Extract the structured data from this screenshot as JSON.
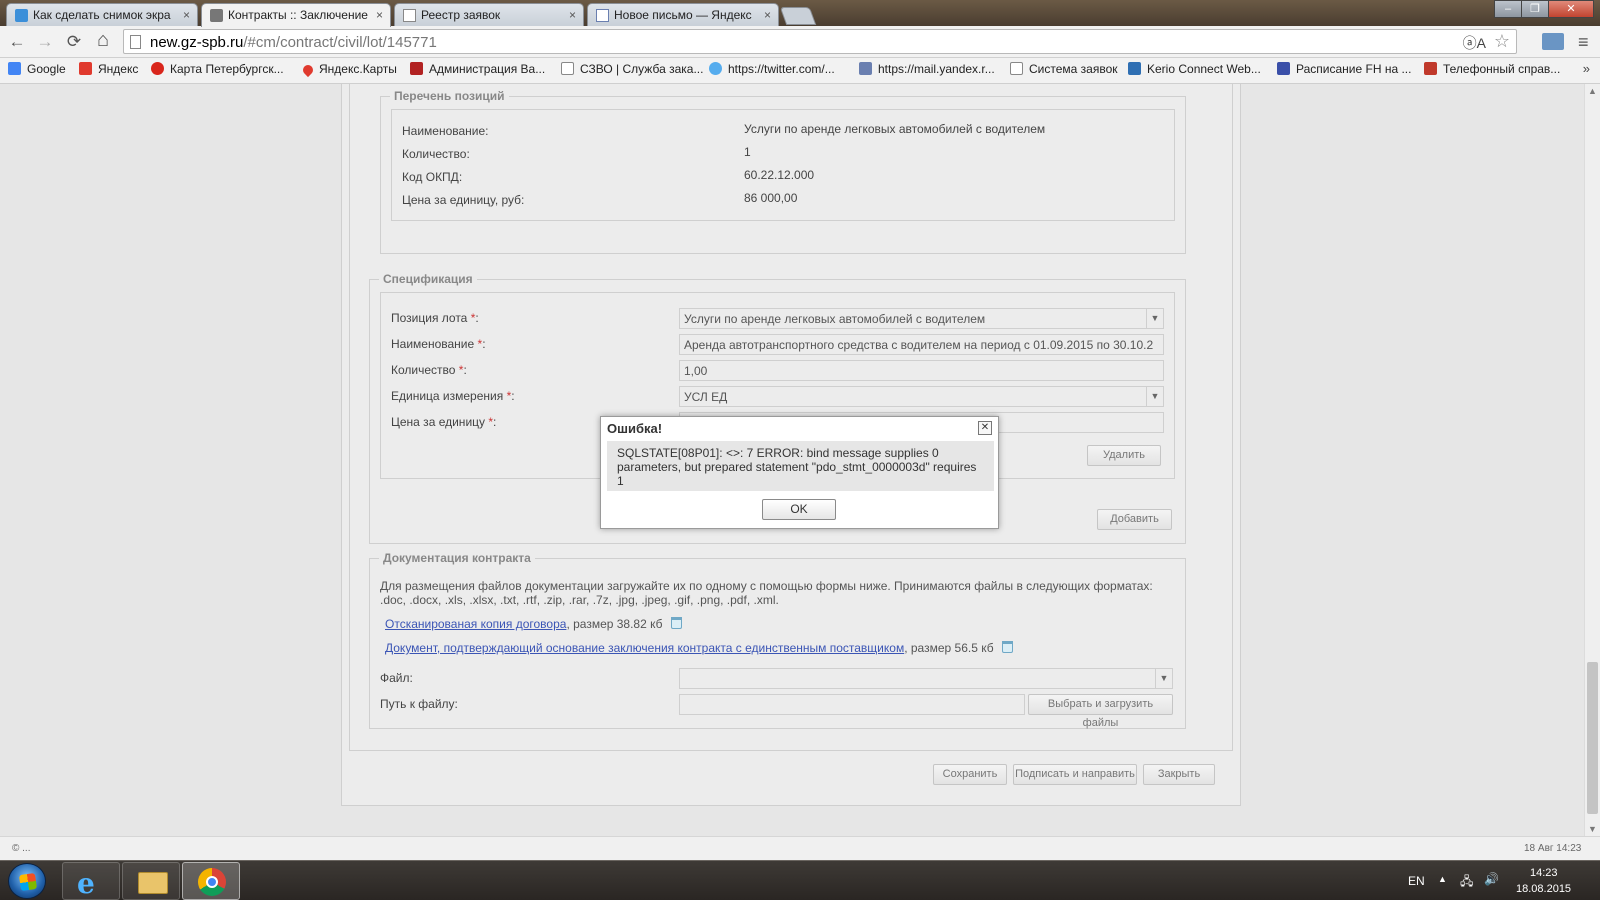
{
  "browser": {
    "tabs": [
      {
        "title": "Как сделать снимок экра",
        "active": false
      },
      {
        "title": "Контракты :: Заключение",
        "active": true
      },
      {
        "title": "Реестр заявок",
        "active": false
      },
      {
        "title": "Новое письмо — Яндекс",
        "active": false
      }
    ],
    "close_glyph": "×",
    "url_host": "new.gz-spb.ru",
    "url_path": "/#cm/contract/civil/lot/145771",
    "translate_glyph": "ⓐA",
    "star_glyph": "☆",
    "back_glyph": "←",
    "forward_glyph": "→",
    "reload_glyph": "⟳",
    "home_glyph": "⌂",
    "menu_glyph": "≡",
    "bookmarks": [
      {
        "label": "Google",
        "icon": "google-icon",
        "color": "#4285f4"
      },
      {
        "label": "Яндекс",
        "icon": "yandex-icon",
        "color": "#e03a2e"
      },
      {
        "label": "Карта Петербургск...",
        "icon": "metro-icon",
        "color": "#d9261c"
      },
      {
        "label": "Яндекс.Карты",
        "icon": "map-pin-icon",
        "color": "#e03a2e"
      },
      {
        "label": "Администрация Ва...",
        "icon": "crest-icon",
        "color": "#b22222"
      },
      {
        "label": "СЗВО | Служба зака...",
        "icon": "page-icon",
        "color": "#ffffff"
      },
      {
        "label": "https://twitter.com/...",
        "icon": "twitter-icon",
        "color": "#55acee"
      },
      {
        "label": "https://mail.yandex.r...",
        "icon": "mail-icon",
        "color": "#6a7fb0"
      },
      {
        "label": "Система заявок",
        "icon": "page-icon",
        "color": "#ffffff"
      },
      {
        "label": "Kerio Connect Web...",
        "icon": "kerio-icon",
        "color": "#2f6fb3"
      },
      {
        "label": "Расписание FH на ...",
        "icon": "schedule-icon",
        "color": "#3a4fa8"
      },
      {
        "label": "Телефонный справ...",
        "icon": "phone-book-icon",
        "color": "#c0392b"
      }
    ],
    "more_glyph": "»"
  },
  "positions": {
    "legend": "Перечень позиций",
    "rows": [
      {
        "label": "Наименование:",
        "value": "Услуги по аренде легковых автомобилей с водителем"
      },
      {
        "label": "Количество:",
        "value": "1"
      },
      {
        "label": "Код ОКПД:",
        "value": "60.22.12.000"
      },
      {
        "label": "Цена за единицу, руб:",
        "value": "86 000,00"
      }
    ]
  },
  "specification": {
    "legend": "Спецификация",
    "req_mark": "*",
    "fields": {
      "lot_position": {
        "label": "Позиция лота",
        "value": "Услуги по аренде легковых автомобилей с водителем"
      },
      "name": {
        "label": "Наименование",
        "value": "Аренда автотранспортного средства с водителем на период с 01.09.2015 по 30.10.2"
      },
      "quantity": {
        "label": "Количество",
        "value": "1,00"
      },
      "unit": {
        "label": "Единица измерения",
        "value": "УСЛ ЕД"
      },
      "price": {
        "label": "Цена за единицу",
        "value": ""
      }
    },
    "delete_label": "Удалить",
    "add_label": "Добавить"
  },
  "documents": {
    "legend": "Документация контракта",
    "hint_line1": "Для размещения файлов документации загружайте их по одному с помощью формы ниже. Принимаются файлы в следующих форматах:",
    "hint_line2": ".doc, .docx, .xls, .xlsx, .txt, .rtf, .zip, .rar, .7z, .jpg, .jpeg, .gif, .png, .pdf, .xml.",
    "files": [
      {
        "name": "Отсканированая копия договора",
        "size": ", размер 38.82 кб"
      },
      {
        "name": "Документ, подтверждающий основание заключения контракта с единственным поставщиком",
        "size": ", размер 56.5 кб"
      }
    ],
    "file_label": "Файл:",
    "file_value": "",
    "path_label": "Путь к файлу:",
    "path_value": "",
    "upload_label": "Выбрать и загрузить файлы"
  },
  "actions": {
    "save": "Сохранить",
    "sign_send": "Подписать и направить",
    "close": "Закрыть"
  },
  "footer": {
    "left": "© ...",
    "right": "18 Авг 14:23"
  },
  "modal": {
    "title": "Ошибка!",
    "close_glyph": "✕",
    "message": "SQLSTATE[08P01]: <>: 7 ERROR: bind message supplies 0 parameters, but prepared statement \"pdo_stmt_0000003d\" requires 1",
    "ok_label": "OK"
  },
  "taskbar": {
    "lang": "EN",
    "time": "14:23",
    "date": "18.08.2015",
    "ie_glyph": "e"
  }
}
